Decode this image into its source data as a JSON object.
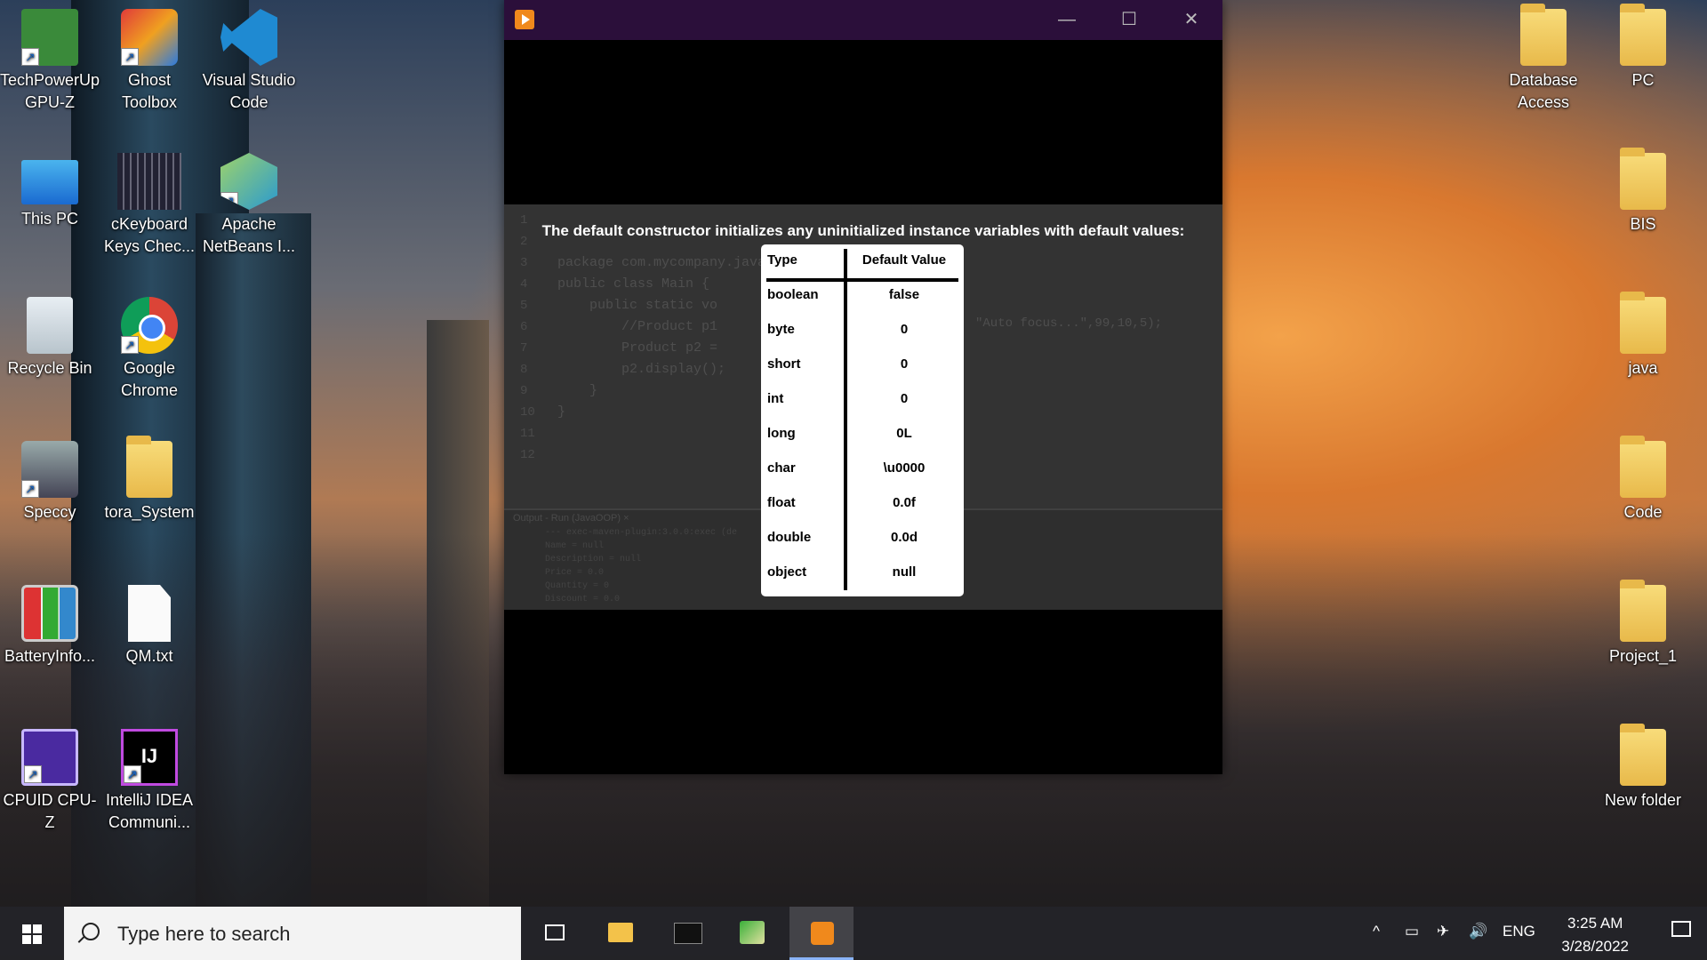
{
  "desktop": {
    "icons": [
      {
        "label": "TechPowerUp GPU-Z",
        "icon": "gpu-z-icon"
      },
      {
        "label": "Ghost Toolbox",
        "icon": "ghost-toolbox-icon"
      },
      {
        "label": "Visual Studio Code",
        "icon": "vscode-icon"
      },
      {
        "label": "This PC",
        "icon": "computer-icon"
      },
      {
        "label": "cKeyboard Keys Chec...",
        "icon": "keyboard-icon"
      },
      {
        "label": "Apache NetBeans I...",
        "icon": "netbeans-icon"
      },
      {
        "label": "Recycle Bin",
        "icon": "recycle-bin-icon"
      },
      {
        "label": "Google Chrome",
        "icon": "chrome-icon"
      },
      {
        "label": "Speccy",
        "icon": "speccy-icon"
      },
      {
        "label": "tora_System",
        "icon": "folder-icon"
      },
      {
        "label": "BatteryInfo...",
        "icon": "battery-icon"
      },
      {
        "label": "QM.txt",
        "icon": "text-file-icon"
      },
      {
        "label": "CPUID CPU-Z",
        "icon": "cpu-z-icon"
      },
      {
        "label": "IntelliJ IDEA Communi...",
        "icon": "intellij-icon"
      },
      {
        "label": "Database Access",
        "icon": "folder-icon"
      },
      {
        "label": "PC",
        "icon": "folder-icon"
      },
      {
        "label": "BIS",
        "icon": "folder-icon"
      },
      {
        "label": "java",
        "icon": "folder-icon"
      },
      {
        "label": "Code",
        "icon": "folder-icon"
      },
      {
        "label": "Project_1",
        "icon": "folder-icon"
      },
      {
        "label": "New folder",
        "icon": "folder-icon"
      }
    ]
  },
  "player": {
    "minimize": "—",
    "maximize": "☐",
    "close": "✕",
    "caption": "The default constructor initializes any uninitialized instance variables with default values:",
    "table": {
      "headers": [
        "Type",
        "Default Value"
      ],
      "rows": [
        [
          "boolean",
          "false"
        ],
        [
          "byte",
          "0"
        ],
        [
          "short",
          "0"
        ],
        [
          "int",
          "0"
        ],
        [
          "long",
          "0L"
        ],
        [
          "char",
          "\\u0000"
        ],
        [
          "float",
          "0.0f"
        ],
        [
          "double",
          "0.0d"
        ],
        [
          "object",
          "null"
        ]
      ]
    },
    "background_code": {
      "line_numbers": [
        "1",
        "2",
        "3",
        "4",
        "5",
        "6",
        "7",
        "8",
        "9",
        "10",
        "11",
        "12"
      ],
      "lines": [
        "package com.mycompany.javaoop;",
        "",
        "public class Main {",
        "",
        "    public static vo",
        "        //Product p1",
        "        Product p2 =",
        "        p2.display();",
        "",
        "    }",
        "}",
        ""
      ],
      "fragment": "\"Auto focus...\",99,10,5);",
      "output_title": "Output - Run (JavaOOP) ×",
      "output_lines": [
        "--- exec-maven-plugin:3.0.0:exec (de",
        "Name = null",
        "Description = null",
        "Price = 0.0",
        "Quantity = 0",
        "Discount = 0.0"
      ]
    }
  },
  "taskbar": {
    "search_placeholder": "Type here to search",
    "language": "ENG",
    "time": "3:25 AM",
    "date": "3/28/2022"
  }
}
